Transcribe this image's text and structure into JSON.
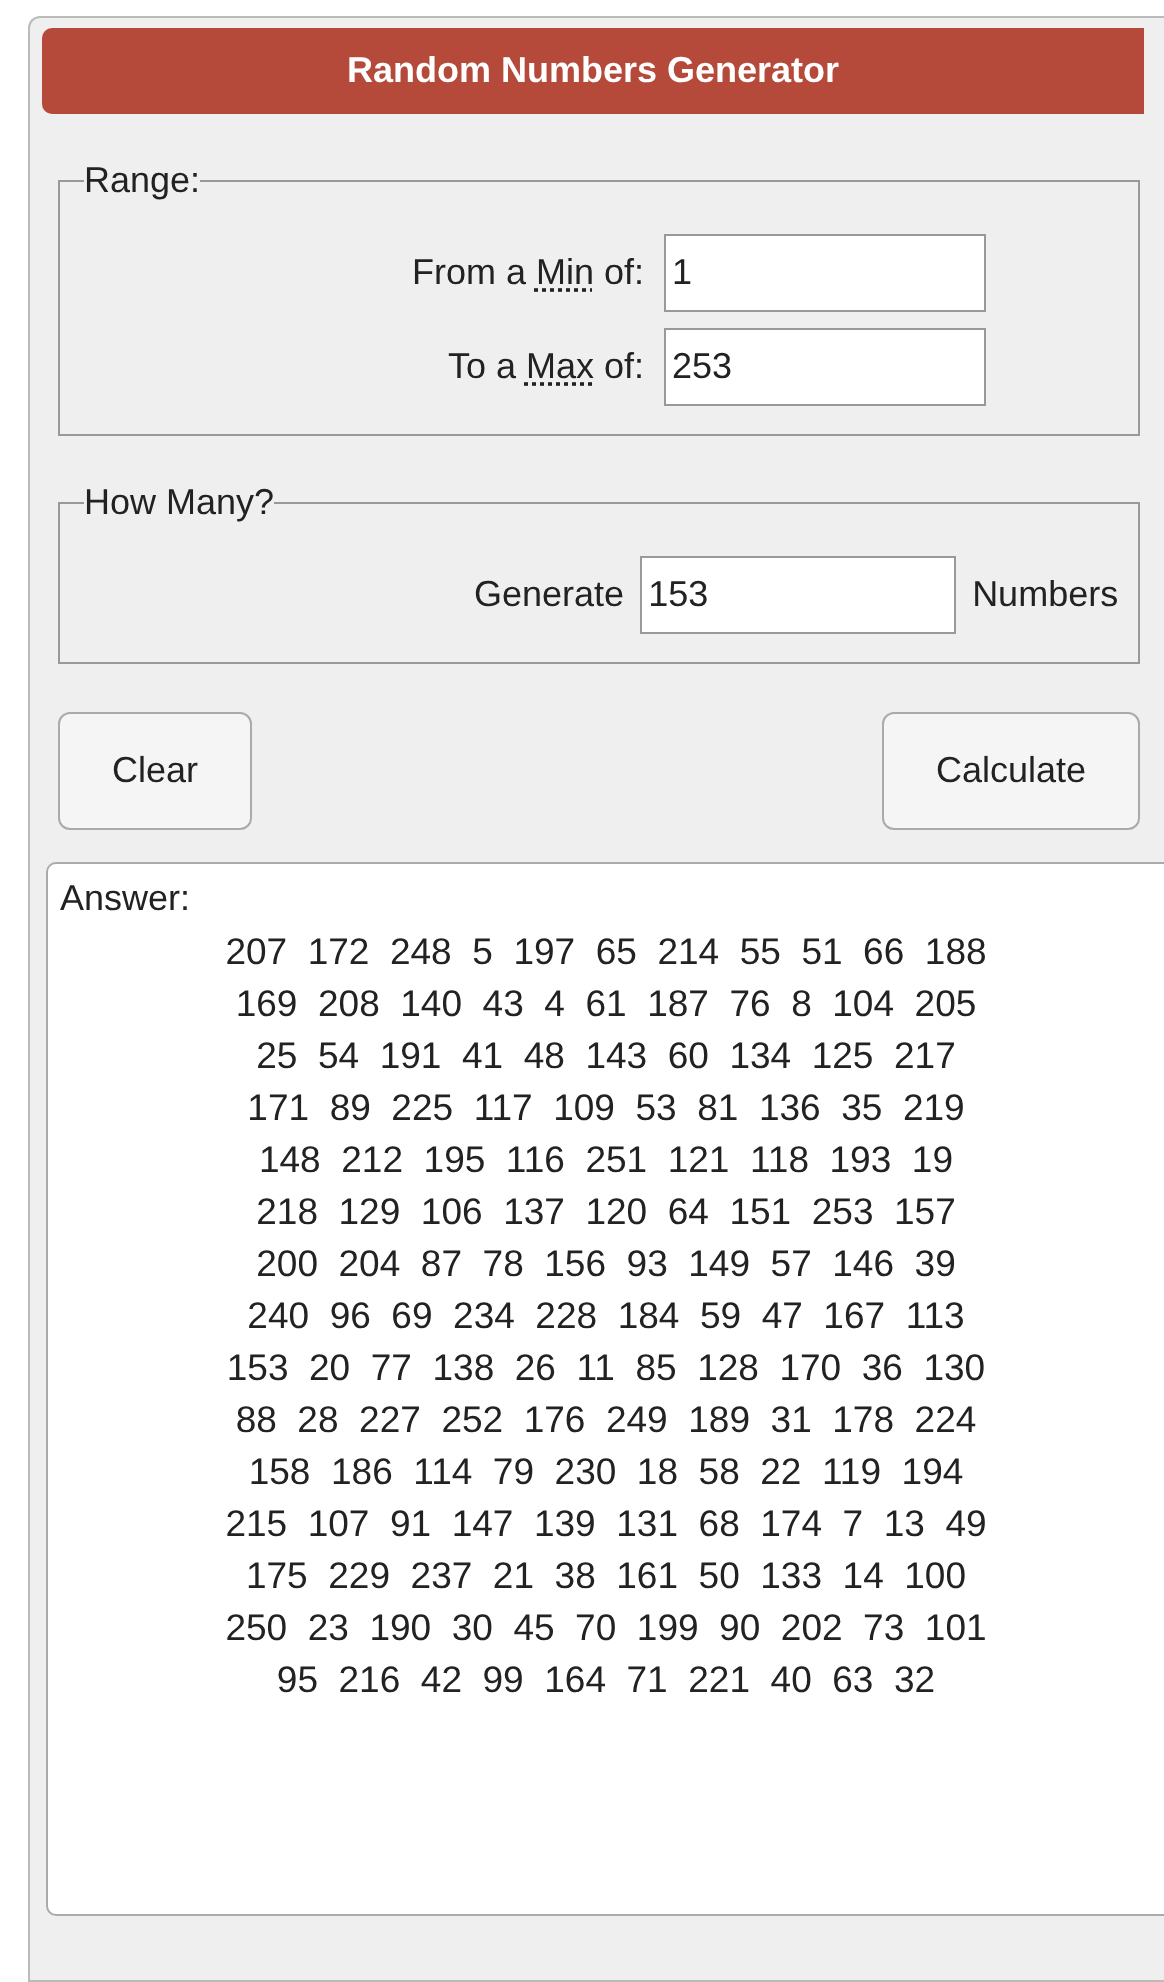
{
  "title": "Random Numbers Generator",
  "range": {
    "legend": "Range:",
    "fields": [
      {
        "prefix": "From a",
        "abbr": "Min",
        "suffix": "of:",
        "value": "1"
      },
      {
        "prefix": "To a",
        "abbr": "Max",
        "suffix": "of:",
        "value": "253"
      }
    ]
  },
  "how_many": {
    "legend": "How Many?",
    "label": "Generate",
    "value": "153",
    "unit": "Numbers"
  },
  "buttons": [
    "Clear",
    "Calculate"
  ],
  "answer": {
    "label": "Answer:",
    "lines": [
      "207  172  248  5  197  65  214  55  51  66  188",
      "169  208  140  43  4  61  187  76  8  104  205",
      "25  54  191  41  48  143  60  134  125  217",
      "171  89  225  117  109  53  81  136  35  219",
      "148  212  195  116  251  121  118  193  19",
      "218  129  106  137  120  64  151  253  157",
      "200  204  87  78  156  93  149  57  146  39",
      "240  96  69  234  228  184  59  47  167  113",
      "153  20  77  138  26  11  85  128  170  36  130",
      "88  28  227  252  176  249  189  31  178  224",
      "158  186  114  79  230  18  58  22  119  194",
      "215  107  91  147  139  131  68  174  7  13  49",
      "175  229  237  21  38  161  50  133  14  100",
      "250  23  190  30  45  70  199  90  202  73  101",
      "95  216  42  99  164  71  221  40  63  32"
    ]
  }
}
